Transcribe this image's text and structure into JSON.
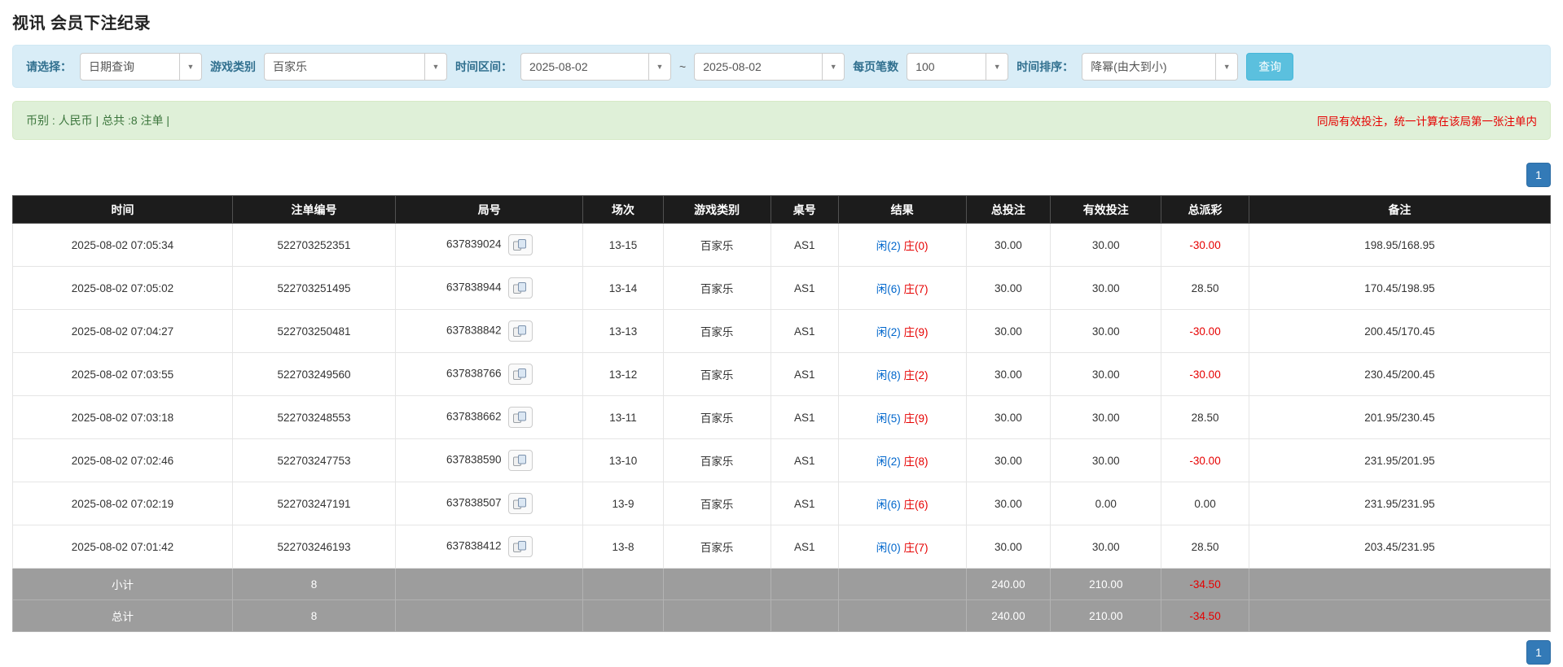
{
  "page": {
    "title": "视讯 会员下注纪录"
  },
  "filter": {
    "select_label": "请选择：",
    "select_value": "日期查询",
    "game_label": "游戏类别",
    "game_value": "百家乐",
    "range_label": "时间区间：",
    "date_from": "2025-08-02",
    "range_separator": "~",
    "date_to": "2025-08-02",
    "per_page_label": "每页笔数",
    "per_page_value": "100",
    "sort_label": "时间排序：",
    "sort_value": "降幂(由大到小)",
    "search_button": "查询"
  },
  "summary": {
    "currency_info": "币别 : 人民币 | 总共 :8 注单 |",
    "notice": "同局有效投注，统一计算在该局第一张注单内"
  },
  "pagination": {
    "current_page": "1"
  },
  "table": {
    "headers": [
      "时间",
      "注单编号",
      "局号",
      "场次",
      "游戏类别",
      "桌号",
      "结果",
      "总投注",
      "有效投注",
      "总派彩",
      "备注"
    ],
    "rows": [
      {
        "time": "2025-08-02 07:05:34",
        "bet_no": "522703252351",
        "round_no": "637839024",
        "session": "13-15",
        "game": "百家乐",
        "table_no": "AS1",
        "result_player": "闲(2)",
        "result_banker": "庄(0)",
        "total_bet": "30.00",
        "valid_bet": "30.00",
        "payout": "-30.00",
        "note": "198.95/168.95"
      },
      {
        "time": "2025-08-02 07:05:02",
        "bet_no": "522703251495",
        "round_no": "637838944",
        "session": "13-14",
        "game": "百家乐",
        "table_no": "AS1",
        "result_player": "闲(6)",
        "result_banker": "庄(7)",
        "total_bet": "30.00",
        "valid_bet": "30.00",
        "payout": "28.50",
        "note": "170.45/198.95"
      },
      {
        "time": "2025-08-02 07:04:27",
        "bet_no": "522703250481",
        "round_no": "637838842",
        "session": "13-13",
        "game": "百家乐",
        "table_no": "AS1",
        "result_player": "闲(2)",
        "result_banker": "庄(9)",
        "total_bet": "30.00",
        "valid_bet": "30.00",
        "payout": "-30.00",
        "note": "200.45/170.45"
      },
      {
        "time": "2025-08-02 07:03:55",
        "bet_no": "522703249560",
        "round_no": "637838766",
        "session": "13-12",
        "game": "百家乐",
        "table_no": "AS1",
        "result_player": "闲(8)",
        "result_banker": "庄(2)",
        "total_bet": "30.00",
        "valid_bet": "30.00",
        "payout": "-30.00",
        "note": "230.45/200.45"
      },
      {
        "time": "2025-08-02 07:03:18",
        "bet_no": "522703248553",
        "round_no": "637838662",
        "session": "13-11",
        "game": "百家乐",
        "table_no": "AS1",
        "result_player": "闲(5)",
        "result_banker": "庄(9)",
        "total_bet": "30.00",
        "valid_bet": "30.00",
        "payout": "28.50",
        "note": "201.95/230.45"
      },
      {
        "time": "2025-08-02 07:02:46",
        "bet_no": "522703247753",
        "round_no": "637838590",
        "session": "13-10",
        "game": "百家乐",
        "table_no": "AS1",
        "result_player": "闲(2)",
        "result_banker": "庄(8)",
        "total_bet": "30.00",
        "valid_bet": "30.00",
        "payout": "-30.00",
        "note": "231.95/201.95"
      },
      {
        "time": "2025-08-02 07:02:19",
        "bet_no": "522703247191",
        "round_no": "637838507",
        "session": "13-9",
        "game": "百家乐",
        "table_no": "AS1",
        "result_player": "闲(6)",
        "result_banker": "庄(6)",
        "total_bet": "30.00",
        "valid_bet": "0.00",
        "payout": "0.00",
        "note": "231.95/231.95"
      },
      {
        "time": "2025-08-02 07:01:42",
        "bet_no": "522703246193",
        "round_no": "637838412",
        "session": "13-8",
        "game": "百家乐",
        "table_no": "AS1",
        "result_player": "闲(0)",
        "result_banker": "庄(7)",
        "total_bet": "30.00",
        "valid_bet": "30.00",
        "payout": "28.50",
        "note": "203.45/231.95"
      }
    ],
    "footer_rows": [
      {
        "label": "小计",
        "count": "8",
        "total_bet": "240.00",
        "valid_bet": "210.00",
        "payout": "-34.50"
      },
      {
        "label": "总计",
        "count": "8",
        "total_bet": "240.00",
        "valid_bet": "210.00",
        "payout": "-34.50"
      }
    ]
  },
  "colors": {
    "filter_bar_bg": "#d9edf7",
    "summary_bar_bg": "#dff0d8",
    "header_bg": "#1c1c1c",
    "footer_row_bg": "#9d9d9d",
    "search_button_bg": "#5bc0de",
    "pagination_bg": "#337ab7",
    "player_blue": "#0066cc",
    "banker_red": "#e60000",
    "negative_red": "#e60000",
    "link_blue": "#337ab7"
  }
}
